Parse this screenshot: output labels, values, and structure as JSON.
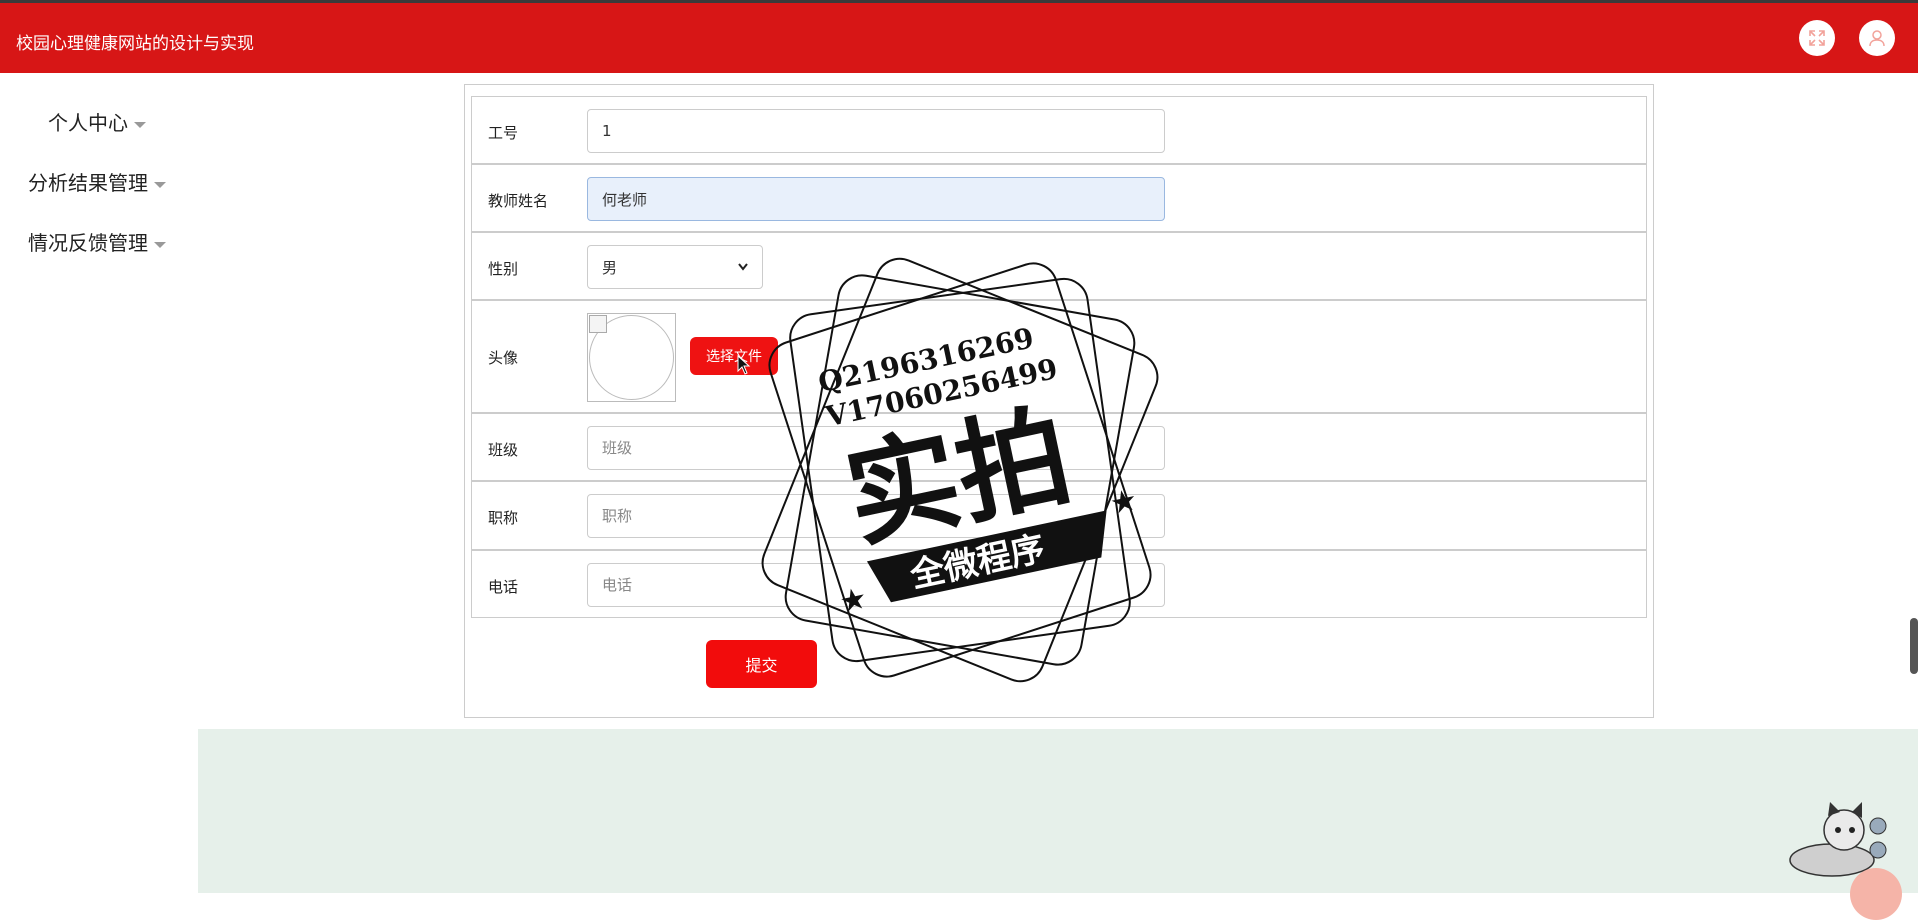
{
  "header": {
    "title": "校园心理健康网站的设计与实现",
    "fullscreen_icon": "fullscreen-icon",
    "user_icon": "user-icon"
  },
  "sidebar": {
    "items": [
      {
        "label": "个人中心"
      },
      {
        "label": "分析结果管理"
      },
      {
        "label": "情况反馈管理"
      }
    ]
  },
  "form": {
    "job_no": {
      "label": "工号",
      "value": "1"
    },
    "teacher_name": {
      "label": "教师姓名",
      "value": "何老师"
    },
    "gender": {
      "label": "性别",
      "selected": "男"
    },
    "avatar": {
      "label": "头像",
      "button": "选择文件"
    },
    "class": {
      "label": "班级",
      "placeholder": "班级"
    },
    "title": {
      "label": "职称",
      "placeholder": "职称"
    },
    "phone": {
      "label": "电话",
      "placeholder": "电话"
    },
    "submit_label": "提交"
  },
  "watermark": {
    "line1": "Q2196316269",
    "line2": "V17060256499",
    "big": "实拍",
    "banner": "全微程序"
  },
  "colors": {
    "header_bg": "#d71616",
    "button_red": "#f20c0c",
    "footer_bg": "#e6f0ea",
    "focus_bg": "#e8f0fb"
  }
}
